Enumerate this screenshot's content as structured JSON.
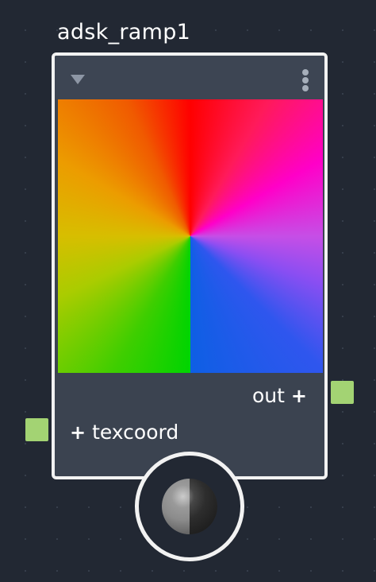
{
  "node": {
    "title": "adsk_ramp1",
    "outputs": [
      {
        "label": "out",
        "color": "#a3d373"
      }
    ],
    "inputs": [
      {
        "label": "texcoord",
        "color": "#a3d373"
      }
    ],
    "add_symbol": "+"
  },
  "icons": {
    "collapse": "triangle-down-icon",
    "menu": "vertical-ellipsis-icon",
    "material_preview": "shaded-sphere-icon"
  },
  "colors": {
    "canvas_background": "#222833",
    "node_body": "#3b4350",
    "node_border": "#f2f2f2",
    "port": "#a3d373"
  }
}
